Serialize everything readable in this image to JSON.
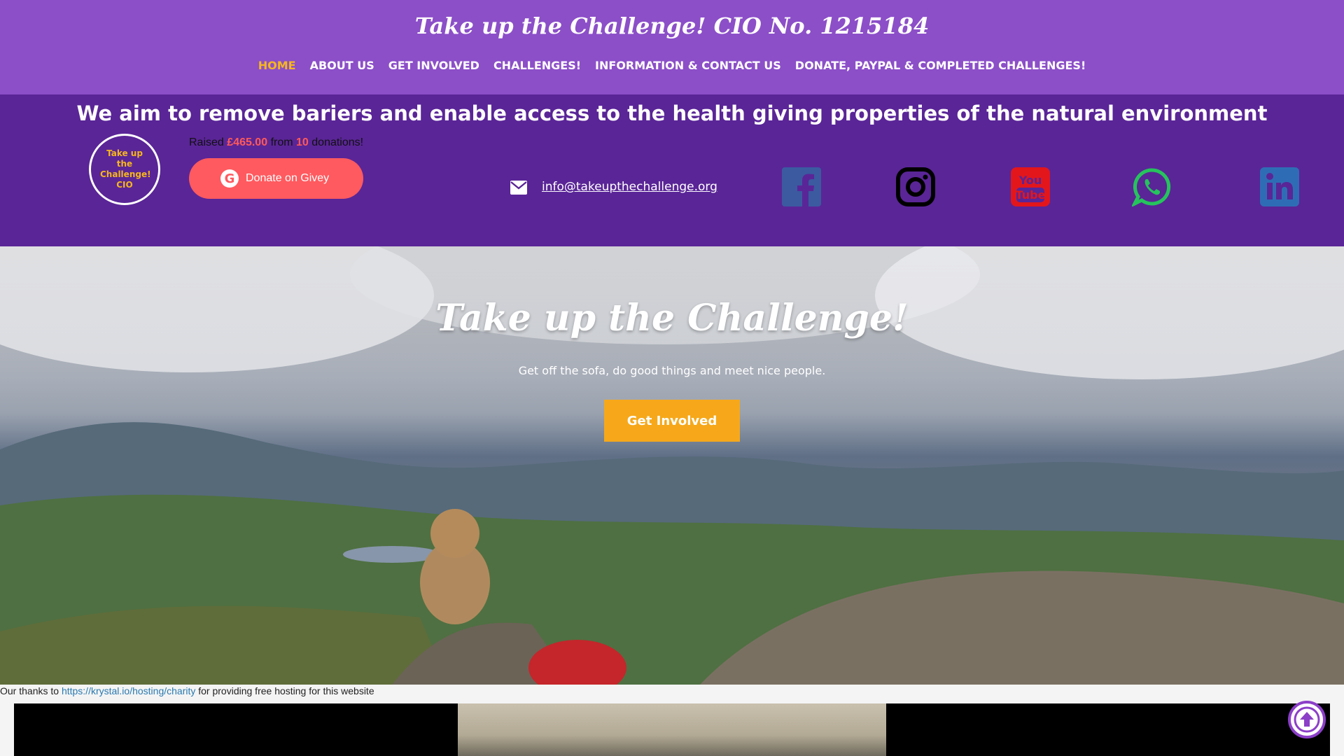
{
  "header": {
    "site_title": "Take up the Challenge! CIO No. 1215184",
    "nav": [
      {
        "label": "HOME",
        "active": true
      },
      {
        "label": "ABOUT US"
      },
      {
        "label": "GET INVOLVED"
      },
      {
        "label": "CHALLENGES!"
      },
      {
        "label": "INFORMATION & CONTACT US"
      },
      {
        "label": "DONATE, PAYPAL & COMPLETED CHALLENGES!"
      }
    ]
  },
  "band": {
    "aim": "We aim to remove bariers and enable access to the health giving properties of the natural environment",
    "logo_text": "Take up the Challenge! CIO",
    "raised_prefix": "Raised",
    "raised_amount": "£465.00",
    "raised_from": "from",
    "donation_count": "10",
    "raised_suffix": "donations!",
    "donate_label": "Donate on Givey",
    "email": "info@takeupthechallenge.org",
    "social_icons": [
      "facebook-icon",
      "instagram-icon",
      "youtube-icon",
      "whatsapp-icon",
      "linkedin-icon"
    ],
    "youtube_text_top": "You",
    "youtube_text_bottom": "Tube"
  },
  "hero": {
    "title": "Take up the Challenge!",
    "subtitle": "Get off the sofa, do good things and meet nice people.",
    "cta_label": "Get Involved"
  },
  "footer": {
    "thanks_prefix": "Our thanks to",
    "thanks_link": "https://krystal.io/hosting/charity",
    "thanks_suffix": "for providing free hosting for this website"
  },
  "colors": {
    "header_bg": "#8c4fc8",
    "band_bg": "#5a2597",
    "accent_orange": "#f6b61e",
    "donate_red": "#ff5a5f"
  }
}
